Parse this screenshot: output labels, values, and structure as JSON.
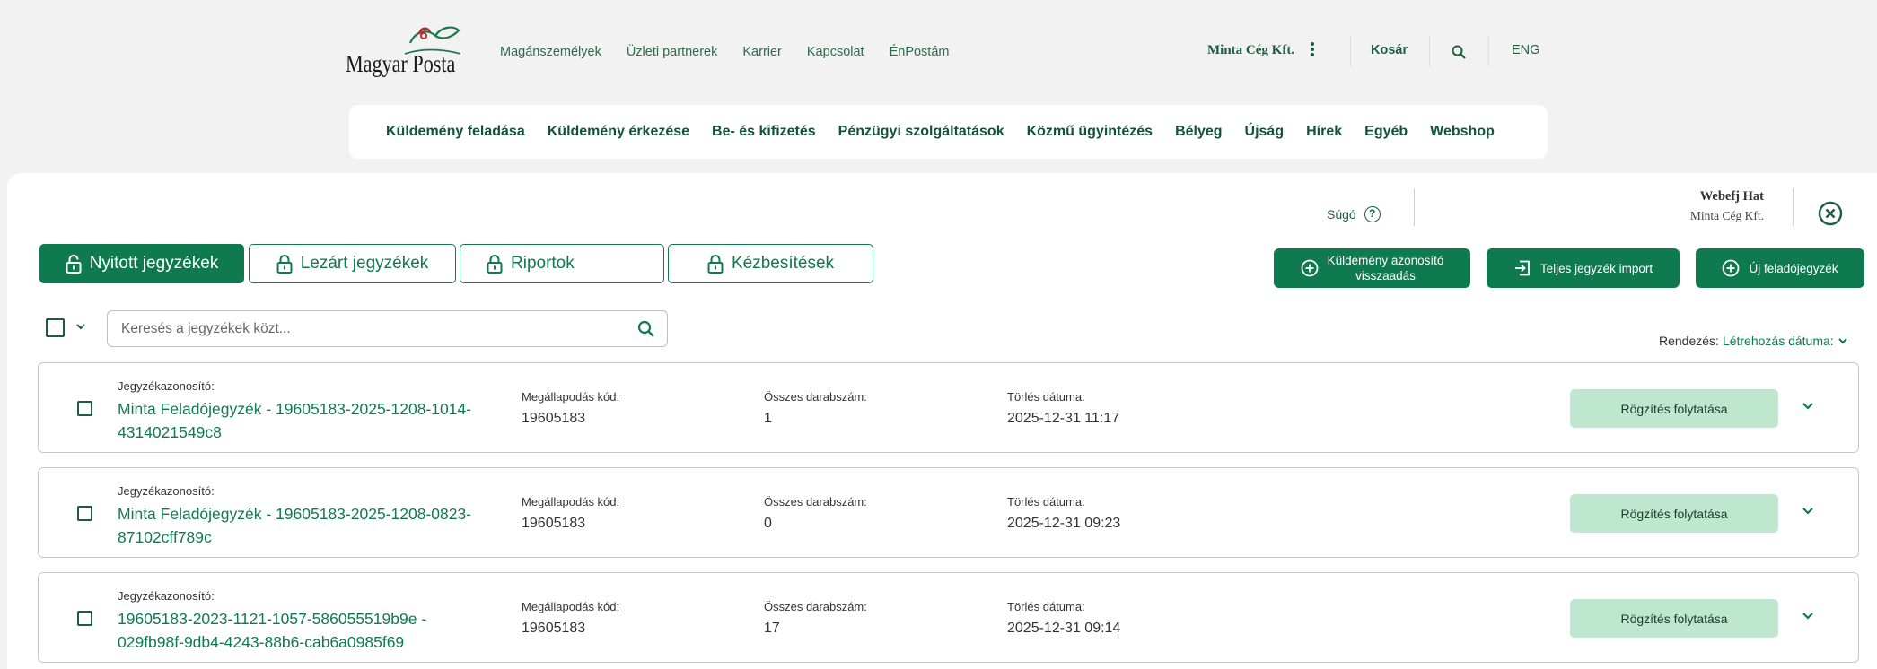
{
  "header": {
    "logo_text": "Magyar Posta",
    "topnav": [
      "Magánszemélyek",
      "Üzleti partnerek",
      "Karrier",
      "Kapcsolat",
      "ÉnPostám"
    ],
    "company": "Minta Cég Kft.",
    "cart": "Kosár",
    "language": "ENG",
    "mainnav": [
      "Küldemény feladása",
      "Küldemény érkezése",
      "Be- és kifizetés",
      "Pénzügyi szolgáltatások",
      "Közmű ügyintézés",
      "Bélyeg",
      "Újság",
      "Hírek",
      "Egyéb",
      "Webshop"
    ]
  },
  "panel": {
    "help": "Súgó",
    "user_name": "Webefj Hat",
    "user_company": "Minta Cég Kft.",
    "tabs": [
      {
        "label": "Nyitott jegyzékek",
        "active": true
      },
      {
        "label": "Lezárt jegyzékek",
        "active": false
      },
      {
        "label": "Riportok",
        "active": false
      },
      {
        "label": "Kézbesítések",
        "active": false
      }
    ],
    "actions": [
      {
        "label_line1": "Küldemény azonosító",
        "label_line2": "visszaadás",
        "icon": "plus-circle-icon"
      },
      {
        "label": "Teljes jegyzék import",
        "icon": "import-icon"
      },
      {
        "label": "Új feladójegyzék",
        "icon": "plus-circle-icon"
      }
    ],
    "search": {
      "placeholder": "Keresés a jegyzékek közt..."
    },
    "sort": {
      "label": "Rendezés:",
      "value": "Létrehozás dátuma:"
    }
  },
  "columns": {
    "id": "Jegyzékazonosító:",
    "contract": "Megállapodás kód:",
    "count": "Összes darabszám:",
    "delete": "Törlés dátuma:",
    "action": "Rögzítés folytatása"
  },
  "rows": [
    {
      "id": "Minta Feladójegyzék - 19605183-2025-1208-1014-4314021549c8",
      "contract": "19605183",
      "count": "1",
      "delete": "2025-12-31 11:17"
    },
    {
      "id": "Minta Feladójegyzék - 19605183-2025-1208-0823-87102cff789c",
      "contract": "19605183",
      "count": "0",
      "delete": "2025-12-31 09:23"
    },
    {
      "id": "19605183-2023-1121-1057-586055519b9e - 029fb98f-9db4-4243-88b6-cab6a0985f69",
      "contract": "19605183",
      "count": "17",
      "delete": "2025-12-31 09:14"
    }
  ],
  "colors": {
    "brand_green": "#0f7a4f",
    "light_green": "#bfe7cf",
    "nav_green": "#12543a"
  }
}
